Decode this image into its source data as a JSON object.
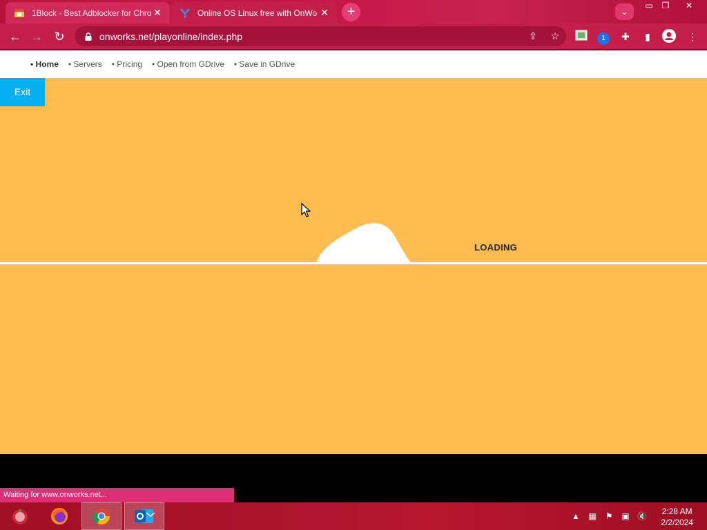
{
  "browser": {
    "tabs": [
      {
        "title": "1Block - Best Adblocker for Chro",
        "icon": "rainbow-block-icon",
        "active": false
      },
      {
        "title": "Online OS Linux free with OnWo",
        "icon": "onworks-y-icon",
        "active": true
      }
    ],
    "new_tab_symbol": "+",
    "tab_close_symbol": "✕",
    "window_controls": {
      "minimize": "▭",
      "restore": "❐",
      "close": "✕"
    },
    "url": "onworks.net/playonline/index.php",
    "extension_badge": "1",
    "accent": "#c41f4a"
  },
  "page": {
    "nav": [
      {
        "label": "• Home"
      },
      {
        "label": "• Servers"
      },
      {
        "label": "• Pricing"
      },
      {
        "label": "• Open from GDrive"
      },
      {
        "label": "• Save in GDrive"
      }
    ],
    "exit_label": "Exit",
    "loading_label": "LOADING",
    "background_color": "#ffbd51",
    "exit_color": "#07aef0"
  },
  "status_text": "Waiting for www.onworks.net...",
  "taskbar": {
    "apps": [
      "start-icon",
      "firefox-icon",
      "chrome-icon",
      "outlook-icon"
    ],
    "time": "2:28 AM",
    "date": "2/2/2024"
  }
}
